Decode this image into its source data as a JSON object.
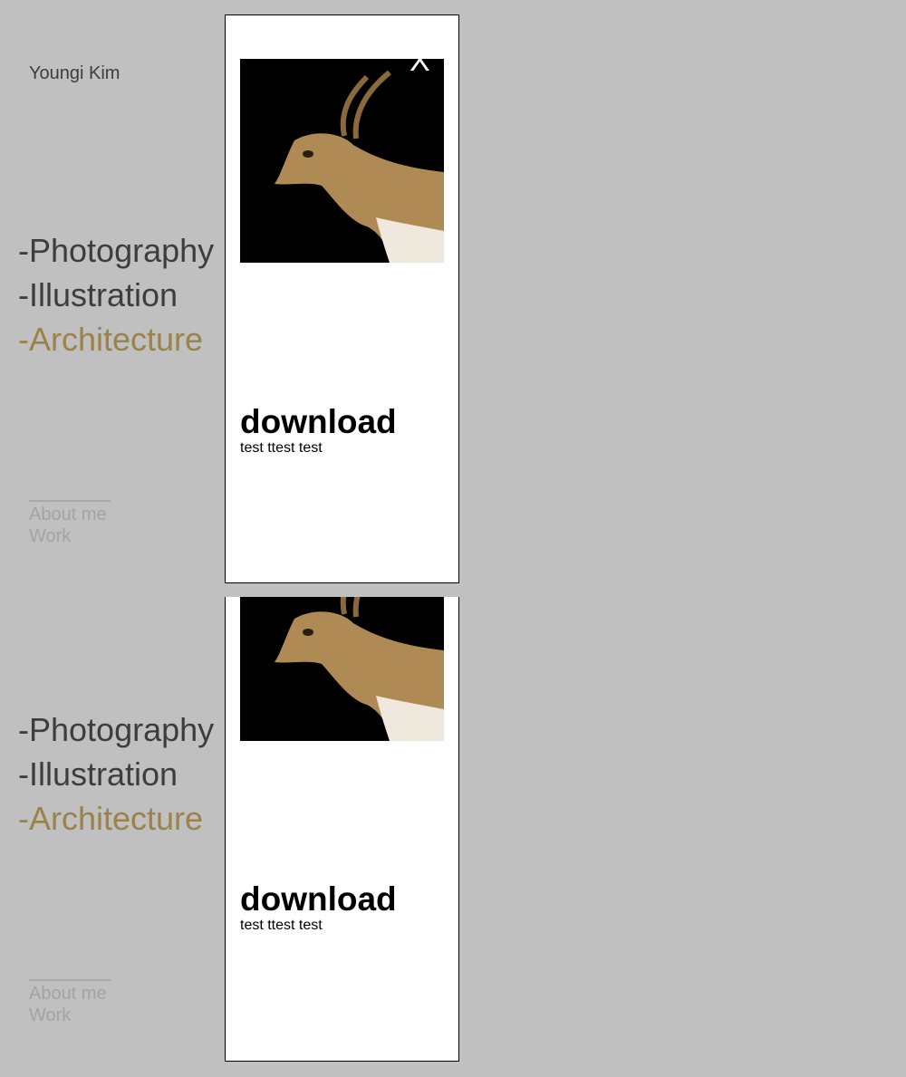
{
  "site": {
    "name": "Youngi Kim"
  },
  "nav": {
    "items": [
      {
        "label": "-Photography",
        "active": false
      },
      {
        "label": "-Illustration",
        "active": false
      },
      {
        "label": "-Architecture",
        "active": true
      }
    ]
  },
  "footer": {
    "about": "About me",
    "work": "Work"
  },
  "panel": {
    "close_label": "X",
    "image_icon": "antelope-photo",
    "download_title": "download",
    "download_desc": "test ttest test"
  },
  "colors": {
    "background": "#c0c0c0",
    "text": "#3d3d3d",
    "accent": "#9a8248",
    "muted": "#a3a3a3"
  }
}
